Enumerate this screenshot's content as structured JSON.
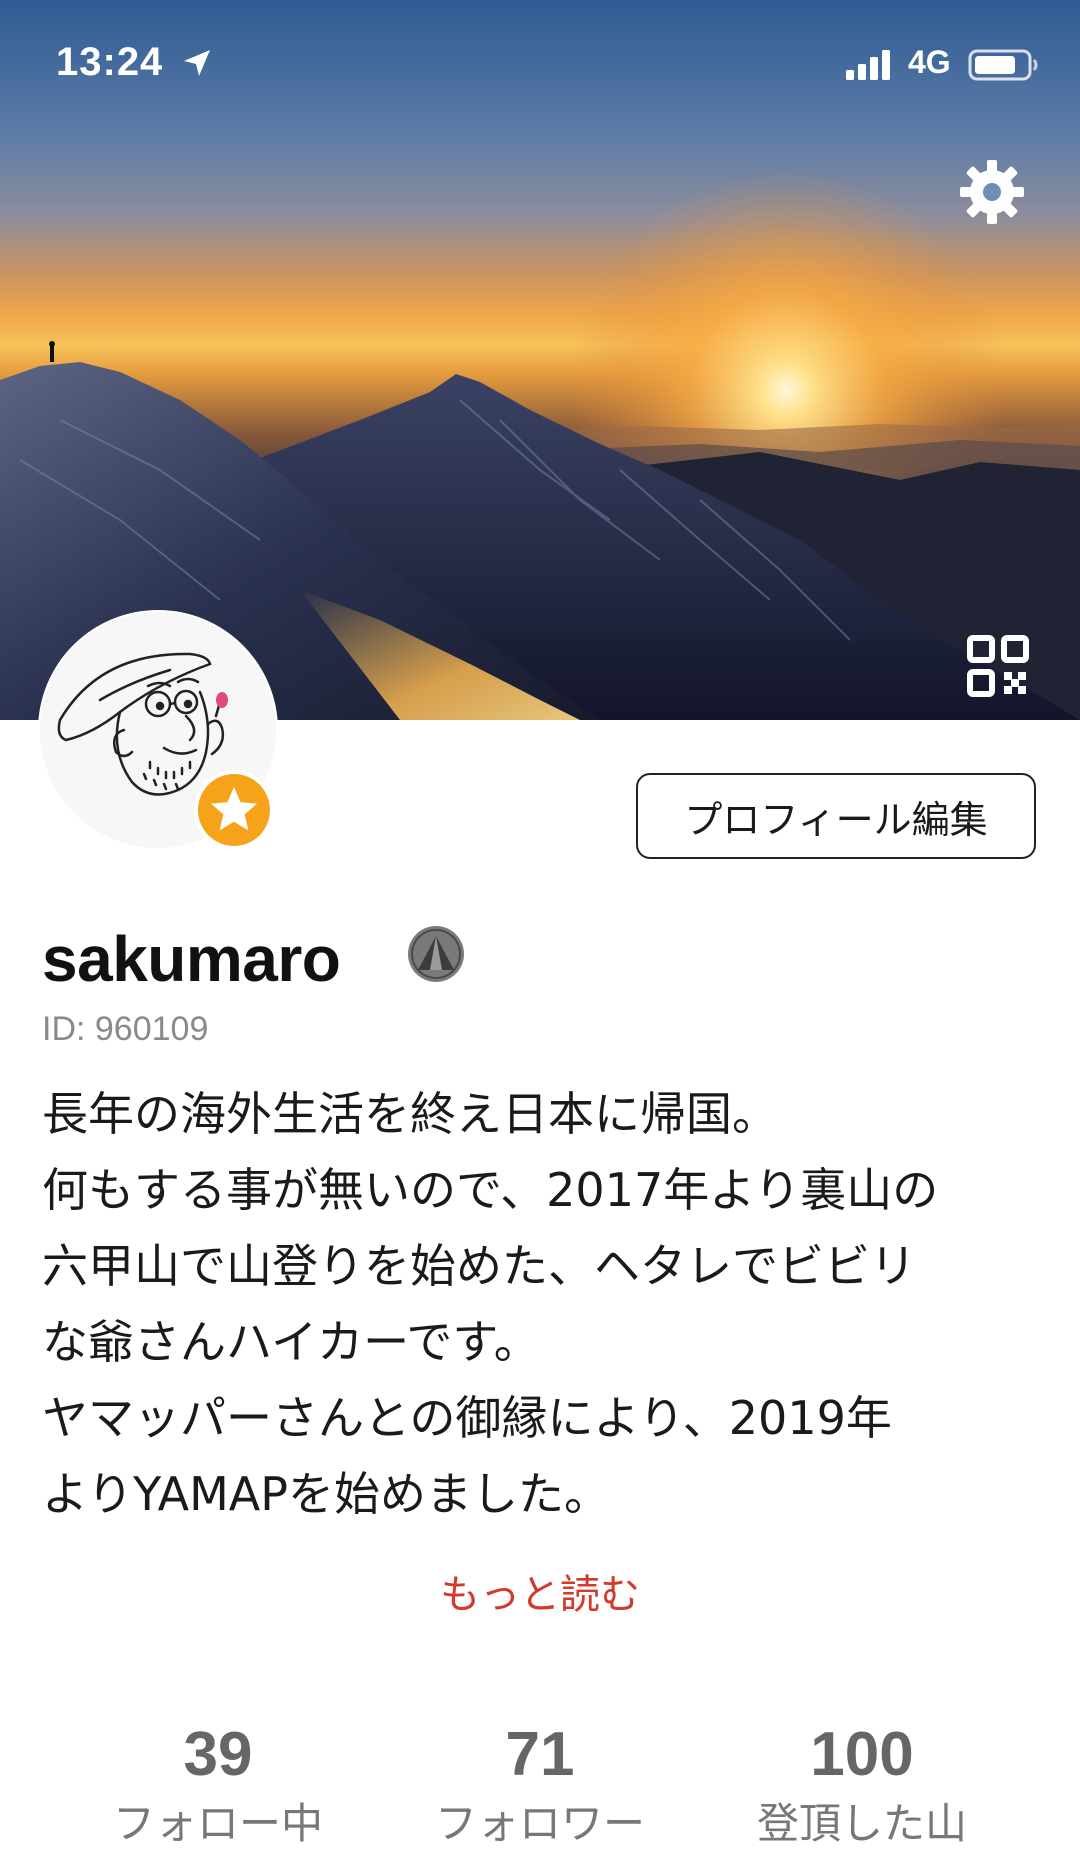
{
  "status_bar": {
    "time": "13:24",
    "network": "4G",
    "icons": [
      "location-arrow-icon",
      "signal-bars-icon",
      "battery-icon"
    ]
  },
  "header": {
    "icons": [
      "gear-icon",
      "qr-code-icon"
    ]
  },
  "profile": {
    "edit_button_label": "プロフィール編集",
    "username": "sakumaro",
    "user_id": "ID: 960109",
    "badge_icon": "star-badge-icon",
    "rank_icon": "mountain-rank-icon",
    "bio_lines": [
      "長年の海外生活を終え日本に帰国。",
      "何もする事が無いので、2017年より裏山の",
      "六甲山で山登りを始めた、ヘタレでビビリ",
      "な爺さんハイカーです。",
      "ヤマッパーさんとの御縁により、2019年",
      "よりYAMAPを始めました。"
    ],
    "read_more_label": "もっと読む"
  },
  "stats": [
    {
      "value": "39",
      "label": "フォロー中"
    },
    {
      "value": "71",
      "label": "フォロワー"
    },
    {
      "value": "100",
      "label": "登頂した山"
    }
  ],
  "colors": {
    "accent_red": "#d33a2c",
    "badge_orange": "#f7a21b",
    "text_primary": "#1a1a1a",
    "text_secondary": "#8a8a8a"
  }
}
